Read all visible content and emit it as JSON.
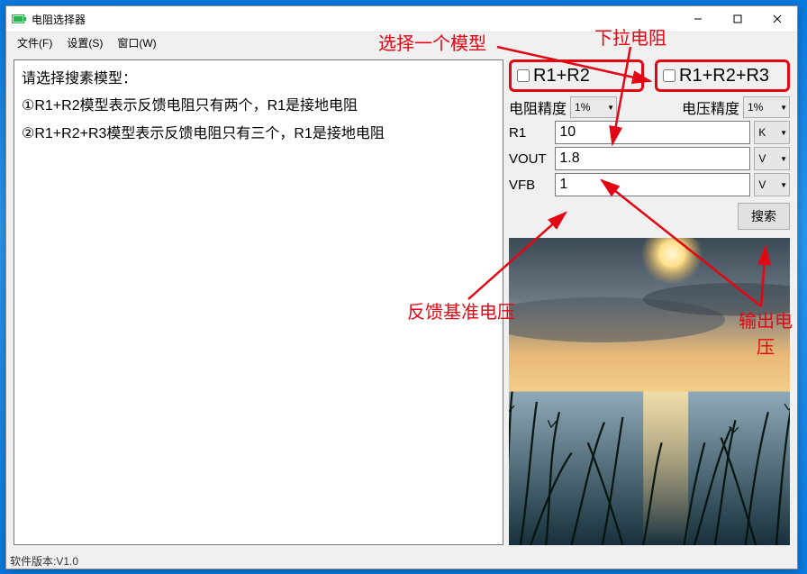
{
  "titlebar": {
    "icon": "battery-icon",
    "title": "电阻选择器",
    "min": "—",
    "max": "□",
    "close": "✕"
  },
  "menu": {
    "file": "文件(F)",
    "settings": "设置(S)",
    "window": "窗口(W)"
  },
  "left": {
    "line1": "请选择搜素模型：",
    "line2": "①R1+R2模型表示反馈电阻只有两个，R1是接地电阻",
    "line3": "②R1+R2+R3模型表示反馈电阻只有三个，R1是接地电阻"
  },
  "models": {
    "m1": "R1+R2",
    "m2": "R1+R2+R3"
  },
  "precision": {
    "res_label": "电阻精度",
    "res_value": "1%",
    "volt_label": "电压精度",
    "volt_value": "1%"
  },
  "fields": {
    "r1_label": "R1",
    "r1_value": "10",
    "r1_unit": "K",
    "vout_label": "VOUT",
    "vout_value": "1.8",
    "vout_unit": "V",
    "vfb_label": "VFB",
    "vfb_value": "1",
    "vfb_unit": "V"
  },
  "search_label": "搜索",
  "status": "软件版本:V1.0",
  "annotations": {
    "select_model": "选择一个模型",
    "pulldown_r": "下拉电阻",
    "vfb_ref": "反馈基准电压",
    "vout_out": "输出电\n压"
  }
}
